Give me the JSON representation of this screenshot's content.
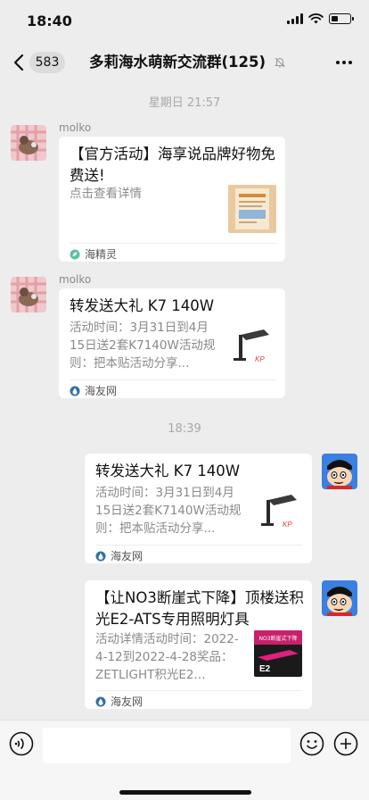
{
  "status_bar": {
    "time": "18:40"
  },
  "header": {
    "unread_count": "583",
    "title": "多莉海水萌新交流群(125)"
  },
  "timestamps": [
    "星期日 21:57",
    "18:39"
  ],
  "messages": [
    {
      "sender": "molko",
      "title": "【官方活动】海享说品牌好物免费送!",
      "desc": "点击查看详情",
      "source": "海精灵",
      "source_icon": "leaf-icon"
    },
    {
      "sender": "molko",
      "title": "转发送大礼 K7 140W",
      "desc": "活动时间：3月31日到4月15日送2套K7140W活动规则：把本贴活动分享...",
      "source": "海友网",
      "source_icon": "drop-icon"
    },
    {
      "sender": "",
      "title": "转发送大礼 K7 140W",
      "desc": "活动时间：3月31日到4月15日送2套K7140W活动规则：把本贴活动分享...",
      "source": "海友网",
      "source_icon": "drop-icon"
    },
    {
      "sender": "",
      "title": "【让NO3断崖式下降】顶楼送积光E2-ATS专用照明灯具",
      "desc": "活动详情活动时间：2022-4-12到2022-4-28奖品：ZETLIGHT积光E2...",
      "source": "海友网",
      "source_icon": "drop-icon",
      "thumb_text": "NO3断崖式下降",
      "thumb_model": "E2"
    }
  ],
  "thumb_brand": "KP",
  "colors": {
    "background": "#ededed",
    "card": "#ffffff",
    "accent": "#e43b3b"
  }
}
